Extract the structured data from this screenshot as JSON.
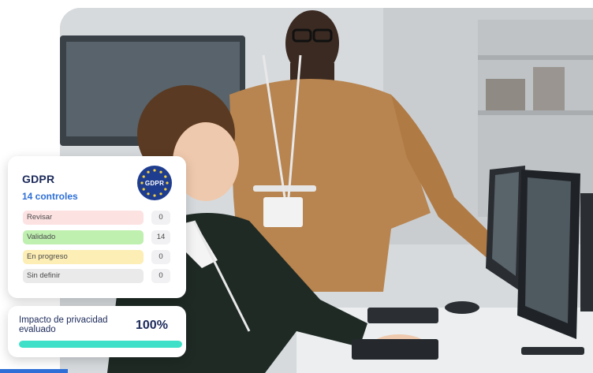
{
  "gdpr_card": {
    "title": "GDPR",
    "subtitle": "14 controles",
    "badge_text": "GDPR",
    "badge_icon": "eu-stars-icon",
    "statuses": [
      {
        "label": "Revisar",
        "count": "0",
        "color": "#fde2e2"
      },
      {
        "label": "Validado",
        "count": "14",
        "color": "#bff0b0"
      },
      {
        "label": "En progreso",
        "count": "0",
        "color": "#fdeeb5"
      },
      {
        "label": "Sin definir",
        "count": "0",
        "color": "#eaeaea"
      }
    ]
  },
  "impact_card": {
    "label": "Impacto de privacidad evaluado",
    "value": "100%",
    "progress": 1.0,
    "bar_color": "#3ee0c8"
  },
  "photo": {
    "icon": "office-photo-two-people-at-computer"
  },
  "colors": {
    "navy": "#1c2a5a",
    "accent_blue": "#2d6fd6"
  }
}
